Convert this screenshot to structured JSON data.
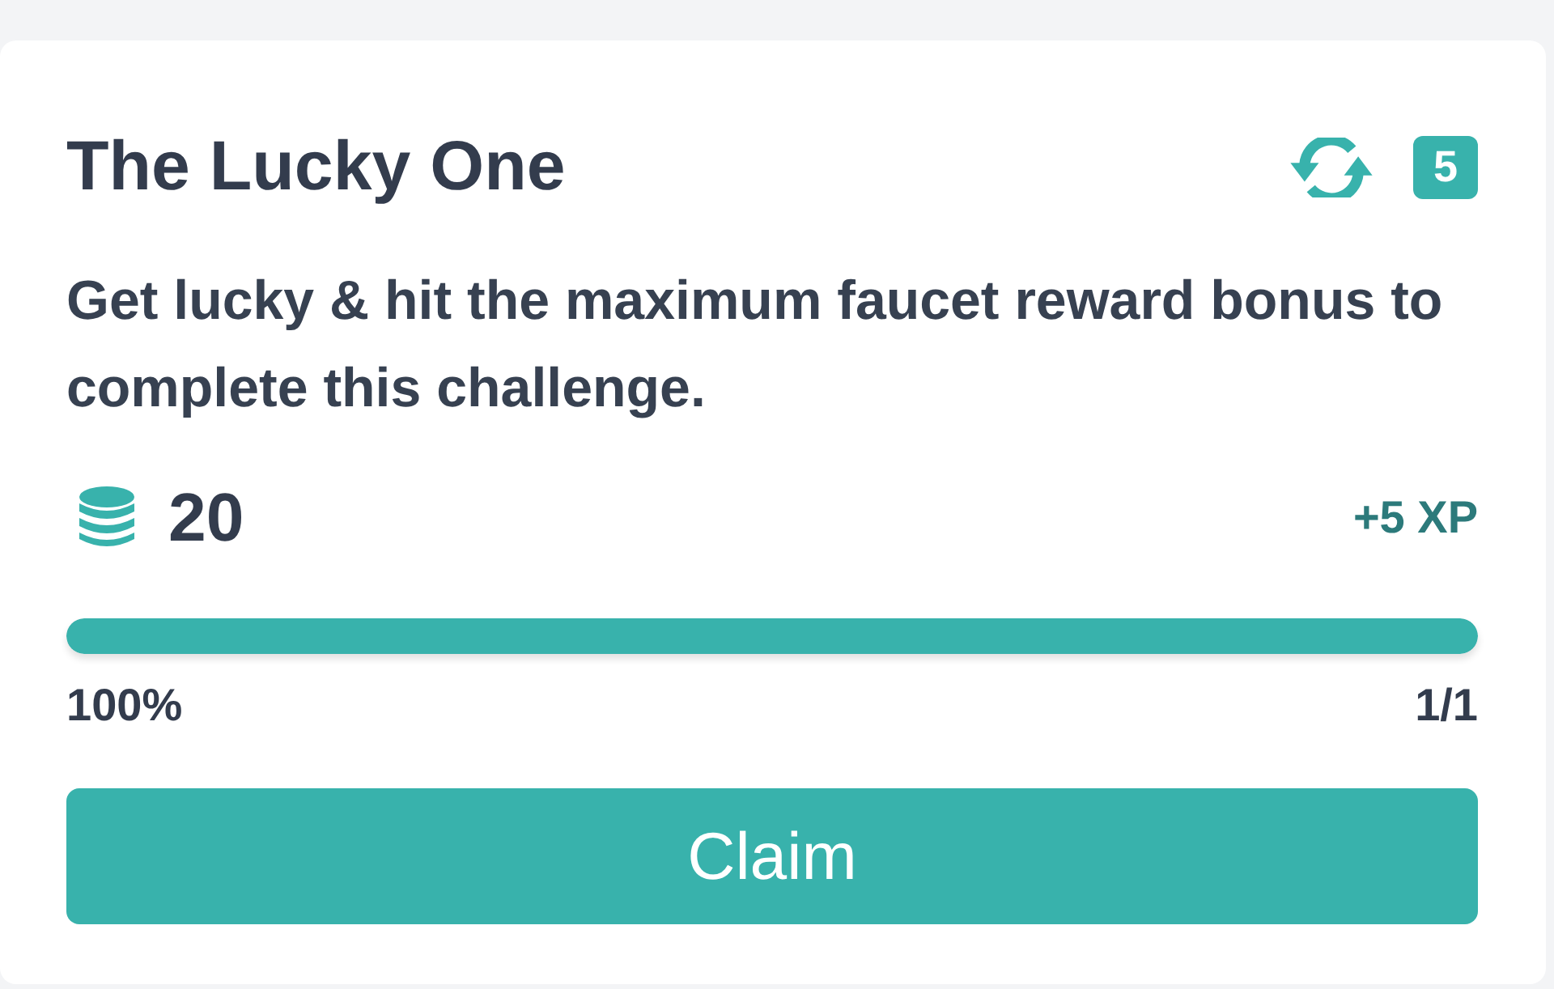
{
  "card": {
    "title": "The Lucky One",
    "badge": "5",
    "description": "Get lucky & hit the maximum faucet reward bonus to complete this challenge.",
    "reward": {
      "amount": "20",
      "xp": "+5 XP"
    },
    "progress": {
      "level": 1,
      "percent": "100%",
      "count": "1/1"
    },
    "button": {
      "label": "Claim"
    }
  }
}
